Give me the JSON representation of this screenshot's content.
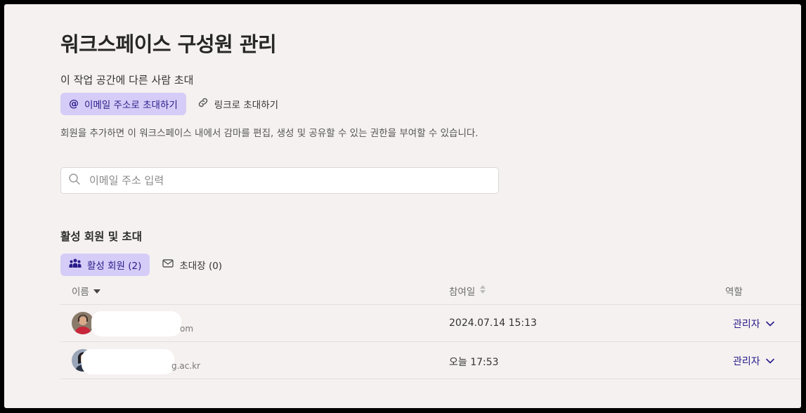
{
  "page": {
    "title": "워크스페이스 구성원 관리",
    "invite_label": "이 작업 공간에 다른 사람 초대",
    "invite_tabs": [
      {
        "label": "이메일 주소로 초대하기",
        "icon": "at-icon",
        "active": true
      },
      {
        "label": "링크로 초대하기",
        "icon": "link-icon",
        "active": false
      }
    ],
    "help_text": "회원을 추가하면 이 워크스페이스 내에서 감마를 편집, 생성 및 공유할 수 있는 권한을 부여할 수 있습니다.",
    "search": {
      "placeholder": "이메일 주소 입력",
      "value": ""
    }
  },
  "members": {
    "section_title": "활성 회원 및 초대",
    "tabs": [
      {
        "label": "활성 회원 (2)",
        "icon": "people-icon",
        "active": true
      },
      {
        "label": "초대장 (0)",
        "icon": "envelope-icon",
        "active": false
      }
    ],
    "columns": {
      "name": "이름",
      "joined": "참여일",
      "role": "역할"
    },
    "rows": [
      {
        "email_tail": "om",
        "joined": "2024.07.14 15:13",
        "role": "관리자"
      },
      {
        "email_tail": "g.ac.kr",
        "joined": "오늘 17:53",
        "role": "관리자"
      }
    ]
  },
  "colors": {
    "accent": "#2a1c8a",
    "active_tab_bg": "#d5cdf7",
    "background": "#f5f1f0"
  }
}
